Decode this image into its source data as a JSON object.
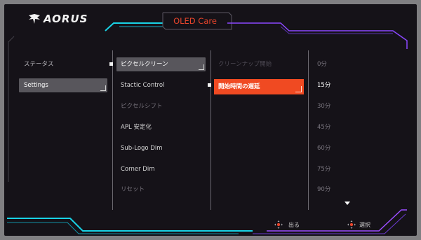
{
  "brand": {
    "logo_text": "AORUS",
    "logo_icon": "aorus-eagle-icon"
  },
  "header": {
    "title": "OLED Care"
  },
  "colors": {
    "accent": "#f04a22",
    "title": "#e8452c",
    "neon_cyan": "#19d3e6",
    "neon_purple": "#9b4dff"
  },
  "menu_level1": [
    {
      "label": "ステータス",
      "selected": false
    },
    {
      "label": "Settings",
      "selected": true
    }
  ],
  "menu_level2": [
    {
      "label": "ピクセルクリーン",
      "selected": true
    },
    {
      "label": "Stactic Control"
    },
    {
      "label": "ピクセルシフト"
    },
    {
      "label": "APL 安定化"
    },
    {
      "label": "Sub-Logo Dim"
    },
    {
      "label": "Corner Dim"
    },
    {
      "label": "リセット"
    }
  ],
  "menu_level3": [
    {
      "label": "クリーンナップ開始"
    },
    {
      "label": "開始時間の遅延",
      "selected": true
    }
  ],
  "menu_level4": [
    {
      "label": "0分"
    },
    {
      "label": "15分",
      "selected": true
    },
    {
      "label": "30分"
    },
    {
      "label": "45分"
    },
    {
      "label": "60分"
    },
    {
      "label": "75分"
    },
    {
      "label": "90分"
    }
  ],
  "footer": {
    "exit_label": "出る",
    "select_label": "選択",
    "exit_icon": "joystick-icon",
    "select_icon": "joystick-icon"
  },
  "scroll": {
    "more_below_icon": "triangle-down-icon"
  }
}
